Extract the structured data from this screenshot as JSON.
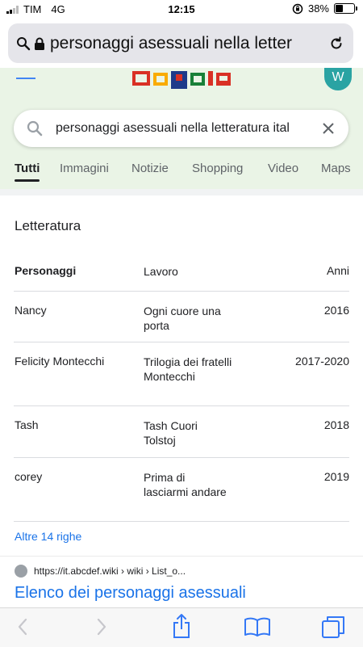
{
  "status_bar": {
    "carrier": "TIM",
    "network": "4G",
    "time": "12:15",
    "battery": "38%",
    "battery_level": 0.38
  },
  "address_bar": {
    "url_text": "personaggi asessuali nella letter"
  },
  "google": {
    "avatar_letter": "W",
    "search_query": "personaggi asessuali nella letteratura ital"
  },
  "tabs": [
    {
      "label": "Tutti",
      "active": true
    },
    {
      "label": "Immagini"
    },
    {
      "label": "Notizie"
    },
    {
      "label": "Shopping"
    },
    {
      "label": "Video"
    },
    {
      "label": "Maps"
    }
  ],
  "card": {
    "title": "Letteratura",
    "headers": {
      "personaggi": "Personaggi",
      "lavoro": "Lavoro",
      "anni": "Anni"
    },
    "rows": [
      {
        "personaggio": "Nancy",
        "lavoro": "Ogni cuore una porta",
        "anni": "2016"
      },
      {
        "personaggio": "Felicity Montecchi",
        "lavoro": "Trilogia dei fratelli Montecchi",
        "anni": "2017-2020"
      },
      {
        "personaggio": "Tash",
        "lavoro": "Tash Cuori Tolstoj",
        "anni": "2018"
      },
      {
        "personaggio": "corey",
        "lavoro": "Prima di lasciarmi andare",
        "anni": "2019"
      }
    ],
    "more_link": "Altre 14 righe"
  },
  "result": {
    "source_url": "https://it.abcdef.wiki › wiki › List_o...",
    "title": "Elenco dei personaggi asessuali"
  },
  "colors": {
    "link_blue": "#1a73e8",
    "header_bg": "#eaf4e6",
    "safari_blue": "#3478f6"
  }
}
